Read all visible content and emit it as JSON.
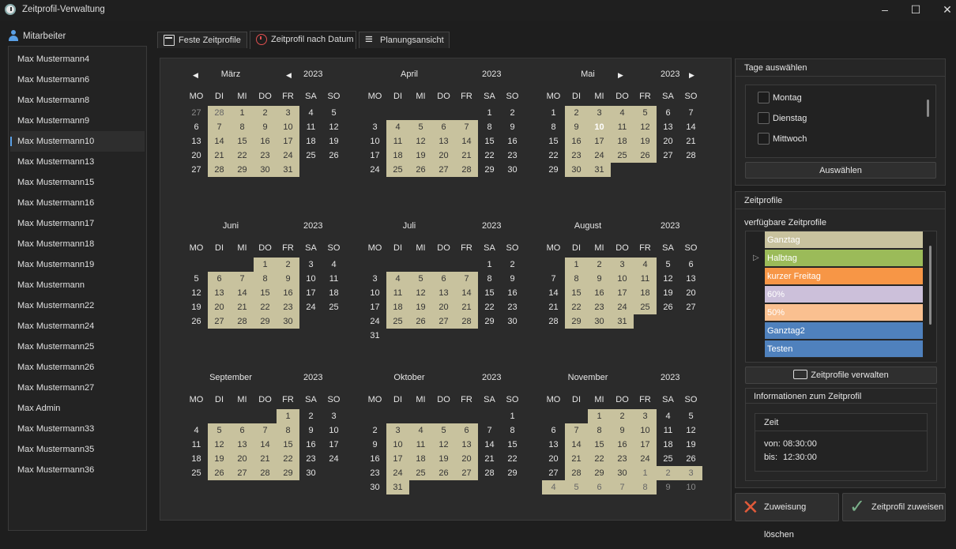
{
  "window": {
    "title": "Zeitprofil-Verwaltung"
  },
  "employees": {
    "header": "Mitarbeiter",
    "selected_index": 4,
    "items": [
      "Max Mustermann4",
      "Max Mustermann6",
      "Max Mustermann8",
      "Max Mustermann9",
      "Max Mustermann10",
      "Max Mustermann13",
      "Max Mustermann15",
      "Max Mustermann16",
      "Max Mustermann17",
      "Max Mustermann18",
      "Max Mustermann19",
      "Max Mustermann",
      "Max Mustermann22",
      "Max Mustermann24",
      "Max Mustermann25",
      "Max Mustermann26",
      "Max Mustermann27",
      "Max Admin",
      "Max Mustermann33",
      "Max Mustermann35",
      "Max Mustermann36"
    ]
  },
  "tabs": [
    {
      "label": "Feste Zeitprofile",
      "icon": "calendar-icon"
    },
    {
      "label": "Zeitprofil nach Datum",
      "icon": "clock-icon",
      "active": true
    },
    {
      "label": "Planungsansicht",
      "icon": "list-icon"
    }
  ],
  "calendar": {
    "weekdays": [
      "MO",
      "DI",
      "MI",
      "DO",
      "FR",
      "SA",
      "SO"
    ],
    "highlight_color": "#c8c29e",
    "today": {
      "month": 2,
      "day": 10
    },
    "months": [
      {
        "name": "März",
        "year": "2023",
        "offset": 2,
        "days": 31,
        "prev_trail": [
          27,
          28
        ],
        "next_lead": [],
        "hl_lead": [
          28
        ],
        "hl": [
          [
            1,
            3
          ],
          [
            7,
            10
          ],
          [
            14,
            17
          ],
          [
            21,
            24
          ],
          [
            28,
            31
          ]
        ],
        "nav_prev": true
      },
      {
        "name": "April",
        "year": "2023",
        "offset": 5,
        "days": 30,
        "prev_trail": [],
        "next_lead": [],
        "hl": [
          [
            4,
            7
          ],
          [
            11,
            14
          ],
          [
            18,
            21
          ],
          [
            25,
            28
          ]
        ]
      },
      {
        "name": "Mai",
        "year": "2023",
        "offset": 0,
        "days": 31,
        "prev_trail": [],
        "next_lead": [],
        "hl": [
          [
            2,
            5
          ],
          [
            9,
            12
          ],
          [
            16,
            19
          ],
          [
            23,
            26
          ],
          [
            30,
            31
          ]
        ],
        "nav_next": true
      },
      {
        "name": "Juni",
        "year": "2023",
        "offset": 3,
        "days": 30,
        "prev_trail": [],
        "next_lead": [],
        "hl": [
          [
            1,
            2
          ],
          [
            6,
            9
          ],
          [
            13,
            16
          ],
          [
            20,
            23
          ],
          [
            27,
            30
          ]
        ]
      },
      {
        "name": "Juli",
        "year": "2023",
        "offset": 5,
        "days": 31,
        "prev_trail": [],
        "next_lead": [],
        "hl": [
          [
            4,
            7
          ],
          [
            11,
            14
          ],
          [
            18,
            21
          ],
          [
            25,
            28
          ]
        ]
      },
      {
        "name": "August",
        "year": "2023",
        "offset": 1,
        "days": 31,
        "prev_trail": [],
        "next_lead": [],
        "hl": [
          [
            1,
            4
          ],
          [
            8,
            11
          ],
          [
            15,
            18
          ],
          [
            22,
            25
          ],
          [
            29,
            31
          ]
        ]
      },
      {
        "name": "September",
        "year": "2023",
        "offset": 4,
        "days": 30,
        "prev_trail": [],
        "next_lead": [],
        "hl": [
          [
            1,
            1
          ],
          [
            5,
            8
          ],
          [
            12,
            15
          ],
          [
            19,
            22
          ],
          [
            26,
            29
          ]
        ]
      },
      {
        "name": "Oktober",
        "year": "2023",
        "offset": 6,
        "days": 31,
        "prev_trail": [],
        "next_lead": [],
        "hl": [
          [
            3,
            6
          ],
          [
            10,
            13
          ],
          [
            17,
            20
          ],
          [
            24,
            27
          ],
          [
            31,
            31
          ]
        ]
      },
      {
        "name": "November",
        "year": "2023",
        "offset": 2,
        "days": 30,
        "prev_trail": [],
        "next_lead": [
          1,
          2,
          3,
          4,
          5,
          6,
          7,
          8,
          9,
          10
        ],
        "hl": [
          [
            1,
            3
          ],
          [
            7,
            10
          ],
          [
            14,
            17
          ],
          [
            21,
            24
          ],
          [
            28,
            30
          ]
        ],
        "hl_lead_next": [
          1,
          2,
          3,
          4,
          5,
          6,
          7,
          8
        ]
      }
    ]
  },
  "days_panel": {
    "title": "Tage auswählen",
    "items": [
      "Montag",
      "Dienstag",
      "Mittwoch"
    ],
    "button": "Auswählen"
  },
  "profiles_panel": {
    "title": "Zeitprofile",
    "subtitle": "verfügbare Zeitprofile",
    "items": [
      {
        "name": "Ganztag",
        "color": "#c8c29e"
      },
      {
        "name": "Halbtag",
        "color": "#9bbb59"
      },
      {
        "name": "kurzer Freitag",
        "color": "#f79646"
      },
      {
        "name": "60%",
        "color": "#ccc0da"
      },
      {
        "name": "50%",
        "color": "#fac090"
      },
      {
        "name": "Ganztag2",
        "color": "#4f81bd"
      },
      {
        "name": "Testen",
        "color": "#4f81bd"
      }
    ],
    "manage_button": "Zeitprofile verwalten"
  },
  "info_panel": {
    "title": "Informationen zum Zeitprofil",
    "section": "Zeit",
    "von_label": "von:",
    "von": "08:30:00",
    "bis_label": "bis:",
    "bis": "12:30:00"
  },
  "actions": {
    "delete": "Zuweisung löschen",
    "assign": "Zeitprofil zuweisen"
  }
}
